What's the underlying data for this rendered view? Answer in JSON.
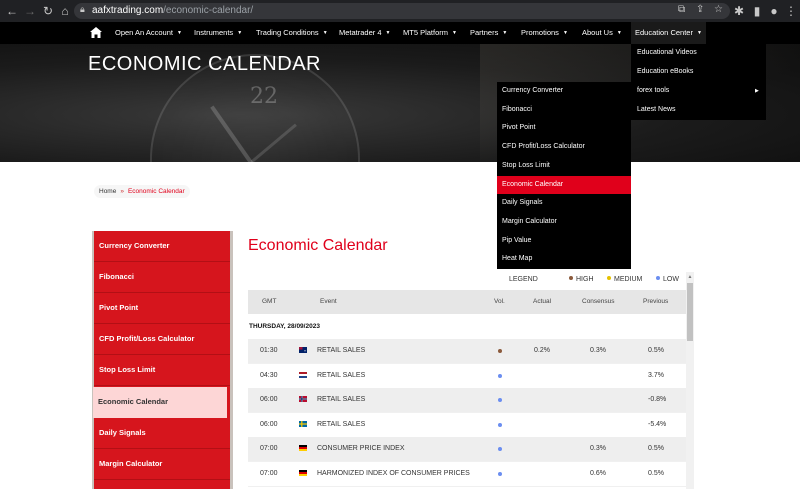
{
  "browser": {
    "url_host": "aafxtrading.com",
    "url_path": "/economic-calendar/"
  },
  "nav": {
    "items": [
      {
        "label": "Open An Account"
      },
      {
        "label": "Instruments"
      },
      {
        "label": "Trading Conditions"
      },
      {
        "label": "Metatrader 4"
      },
      {
        "label": "MT5 Platform"
      },
      {
        "label": "Partners"
      },
      {
        "label": "Promotions"
      },
      {
        "label": "About Us"
      },
      {
        "label": "Education Center"
      }
    ]
  },
  "education_menu": {
    "items": [
      "Educational Videos",
      "Education eBooks",
      "forex tools",
      "Latest News"
    ]
  },
  "forex_tools_menu": {
    "items": [
      "Currency Converter",
      "Fibonacci",
      "Pivot Point",
      "CFD Profit/Loss Calculator",
      "Stop Loss Limit",
      "Economic Calendar",
      "Daily Signals",
      "Margin Calculator",
      "Pip Value",
      "Heat Map"
    ],
    "active_index": 5
  },
  "hero": {
    "title": "ECONOMIC CALENDAR",
    "clock_number": "22"
  },
  "breadcrumb": {
    "home": "Home",
    "separator": "»",
    "current": "Economic Calendar"
  },
  "sidebar": {
    "items": [
      "Currency Converter",
      "Fibonacci",
      "Pivot Point",
      "CFD Profit/Loss Calculator",
      "Stop Loss Limit",
      "Economic Calendar",
      "Daily Signals",
      "Margin Calculator"
    ],
    "active_index": 5
  },
  "main": {
    "title": "Economic Calendar"
  },
  "calendar": {
    "legend": {
      "label": "LEGEND",
      "high": "HIGH",
      "medium": "MEDIUM",
      "low": "LOW",
      "high_color": "#8b5a3c",
      "medium_color": "#e5c100",
      "low_color": "#6b8ef0"
    },
    "columns": {
      "gmt": "GMT",
      "event": "Event",
      "vol": "Vol.",
      "actual": "Actual",
      "consensus": "Consensus",
      "previous": "Previous"
    },
    "date": "THURSDAY, 28/09/2023",
    "rows": [
      {
        "time": "01:30",
        "flag": "australia",
        "event": "RETAIL SALES",
        "vol": "high",
        "actual": "0.2%",
        "consensus": "0.3%",
        "previous": "0.5%"
      },
      {
        "time": "04:30",
        "flag": "netherlands",
        "event": "RETAIL SALES",
        "vol": "low",
        "actual": "",
        "consensus": "",
        "previous": "3.7%"
      },
      {
        "time": "06:00",
        "flag": "norway",
        "event": "RETAIL SALES",
        "vol": "low",
        "actual": "",
        "consensus": "",
        "previous": "-0.8%"
      },
      {
        "time": "06:00",
        "flag": "sweden",
        "event": "RETAIL SALES",
        "vol": "low",
        "actual": "",
        "consensus": "",
        "previous": "-5.4%"
      },
      {
        "time": "07:00",
        "flag": "germany",
        "event": "CONSUMER PRICE INDEX",
        "vol": "low",
        "actual": "",
        "consensus": "0.3%",
        "previous": "0.5%"
      },
      {
        "time": "07:00",
        "flag": "germany",
        "event": "HARMONIZED INDEX OF CONSUMER PRICES",
        "vol": "low",
        "actual": "",
        "consensus": "0.6%",
        "previous": "0.5%"
      }
    ]
  }
}
